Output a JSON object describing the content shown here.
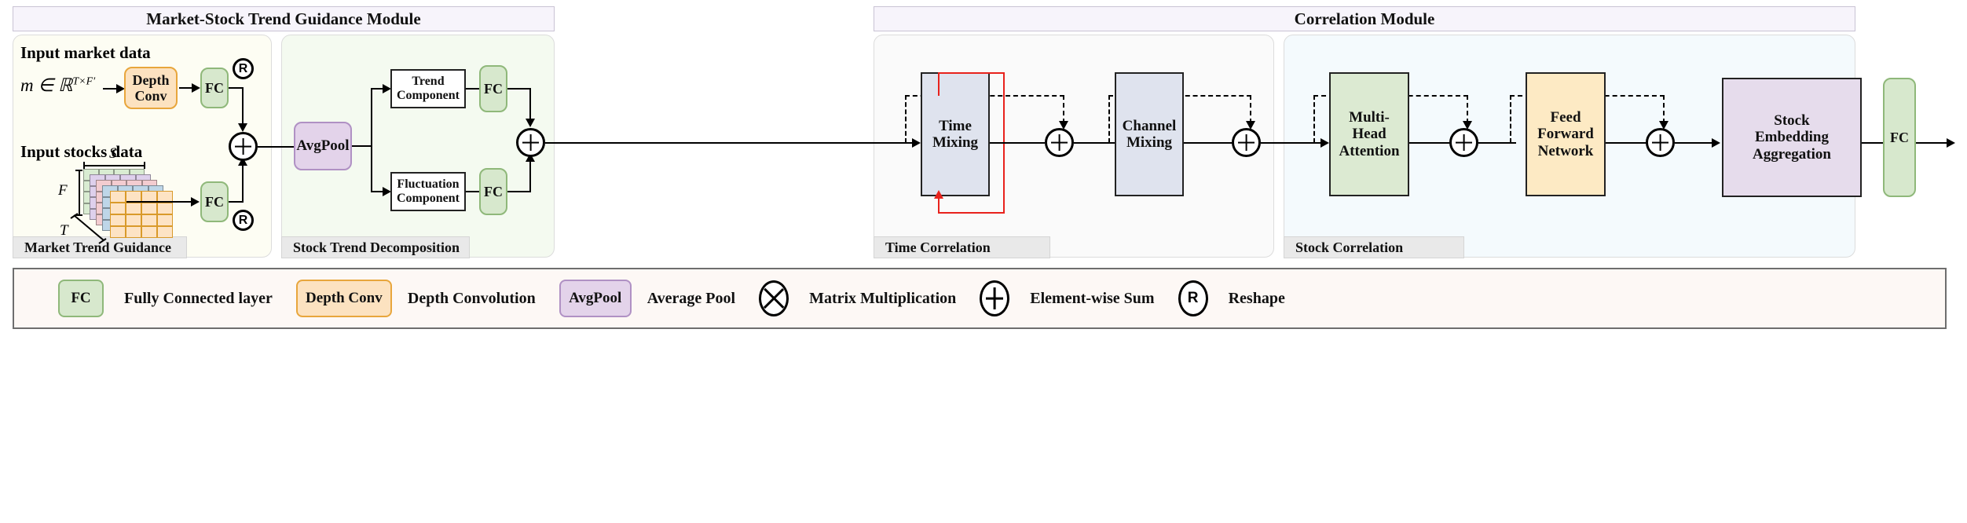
{
  "modules": [
    {
      "id": "market_stock",
      "title": "Market-Stock Trend Guidance Module"
    },
    {
      "id": "correlation",
      "title": "Correlation Module"
    }
  ],
  "subpanels": [
    {
      "id": "market_trend_guidance",
      "caption": "Market Trend Guidance"
    },
    {
      "id": "stock_trend_decomposition",
      "caption": "Stock Trend Decomposition"
    },
    {
      "id": "time_correlation",
      "caption": "Time Correlation"
    },
    {
      "id": "stock_correlation",
      "caption": "Stock Correlation"
    }
  ],
  "market_panel": {
    "input_market_label": "Input market data",
    "market_formula": "m ∈ ℝ",
    "market_formula_sup": "T×F′",
    "input_stocks_label": "Input stocks data",
    "cube_dims": {
      "width": "S",
      "height": "F",
      "depth": "T"
    },
    "depth_conv_label": "Depth\nConv",
    "fc_top_label": "FC",
    "fc_bottom_label": "FC",
    "reshape_top": "R",
    "reshape_bottom": "R",
    "sum_symbol": "+"
  },
  "decomposition_panel": {
    "avgpool_label": "AvgPool",
    "trend_label": "Trend\nComponent",
    "fluctuation_label": "Fluctuation\nComponent",
    "fc_trend_label": "FC",
    "fc_fluct_label": "FC",
    "sum_symbol": "+"
  },
  "time_correlation_panel": {
    "time_mixing_label": "Time\nMixing",
    "channel_mixing_label": "Channel\nMixing",
    "sum_symbol_1": "+",
    "sum_symbol_2": "+"
  },
  "stock_correlation_panel": {
    "mha_label": "Multi-\nHead\nAttention",
    "ffn_label": "Feed\nForward\nNetwork",
    "sum_symbol_1": "+",
    "sum_symbol_2": "+"
  },
  "output_stage": {
    "aggregation_label": "Stock\nEmbedding\nAggregation",
    "fc_label": "FC"
  },
  "legend": {
    "items": [
      {
        "kind": "chip",
        "glyph": "FC",
        "label": "Fully Connected layer",
        "fill": "#d7e8cd",
        "stroke": "#8fb87a",
        "chip_w": 58,
        "chip_h": 48
      },
      {
        "kind": "chip",
        "glyph": "Depth Conv",
        "label": "Depth Convolution",
        "fill": "#fce2c0",
        "stroke": "#e8a63c",
        "chip_w": 122,
        "chip_h": 48
      },
      {
        "kind": "chip",
        "glyph": "AvgPool",
        "label": "Average Pool",
        "fill": "#e3d3ea",
        "stroke": "#b091c4",
        "chip_w": 92,
        "chip_h": 48
      },
      {
        "kind": "circle",
        "glyph": "x",
        "label": "Matrix Multiplication",
        "chip_w": 40,
        "chip_h": 48
      },
      {
        "kind": "circle",
        "glyph": "+",
        "label": "Element-wise Sum",
        "chip_w": 40,
        "chip_h": 48
      },
      {
        "kind": "circle",
        "glyph": "R",
        "label": "Reshape",
        "chip_w": 40,
        "chip_h": 48
      }
    ]
  },
  "colors": {
    "green_fill": "#d7e8cd",
    "green_stroke": "#8fb87a",
    "orange_fill": "#fce2c0",
    "orange_stroke": "#e8a63c",
    "purple_fill": "#e3d3ea",
    "purple_stroke": "#b091c4",
    "bluegray_fill": "#dfe3ee",
    "bluegray_stroke": "#222222",
    "cream_fill": "#fdeac4",
    "cream_stroke": "#222222",
    "white_fill": "#ffffff",
    "black_stroke": "#222222",
    "red_loop": "#e8221c",
    "panel_market": "#fdfdf3",
    "panel_decomp": "#f4faf0",
    "panel_time": "#fafafa",
    "panel_stock": "#f4fafd",
    "module_header": "#f7f4fb",
    "caption_bg": "#e9e9e9",
    "legend_bg": "#fdf8f5",
    "legend_border": "#6e6e6e"
  }
}
